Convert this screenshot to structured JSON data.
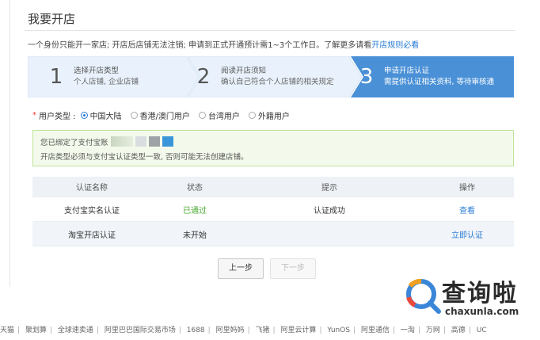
{
  "header": {
    "title": "我要开店"
  },
  "intro": {
    "text": "一个身份只能开一家店; 开店后店铺无法注销; 申请到正式开通预计需1~3个工作日。了解更多请看",
    "link": "开店规则必看"
  },
  "steps": [
    {
      "num": "1",
      "title": "选择开店类型",
      "sub": "个人店铺, 企业店铺"
    },
    {
      "num": "2",
      "title": "阅读开店须知",
      "sub": "确认自己符合个人店铺的相关规定"
    },
    {
      "num": "3",
      "title": "申请开店认证",
      "sub": "需提供认证相关资料, 等待审核通"
    }
  ],
  "user_type": {
    "label": "用户类型 :",
    "options": [
      "中国大陆",
      "香港/澳门用户",
      "台湾用户",
      "外籍用户"
    ],
    "selected": "中国大陆"
  },
  "notice": {
    "line1": "您已绑定了支付宝账",
    "line2": "开店类型必须与支付宝认证类型一致, 否则可能无法创建店铺。"
  },
  "table": {
    "headers": [
      "认证名称",
      "状态",
      "提示",
      "操作"
    ],
    "rows": [
      {
        "name": "支付宝实名认证",
        "status": "已通过",
        "hint": "认证成功",
        "action": "查看"
      },
      {
        "name": "淘宝开店认证",
        "status": "未开始",
        "hint": "",
        "action": "立即认证"
      }
    ]
  },
  "buttons": {
    "prev": "上一步",
    "next": "下一步"
  },
  "footer": [
    "天猫",
    "聚划算",
    "全球速卖通",
    "阿里巴巴国际交易市场",
    "1688",
    "阿里妈妈",
    "飞猪",
    "阿里云计算",
    "YunOS",
    "阿里通信",
    "一淘",
    "万网",
    "高德",
    "UC"
  ],
  "watermark": {
    "text": "查询啦",
    "sub": "chaxunla.com"
  },
  "colors": {
    "accent": "#2b7dd6",
    "active_step": "#4a90d6",
    "step_bg": "#e9f2fc",
    "success": "#4aa931"
  }
}
